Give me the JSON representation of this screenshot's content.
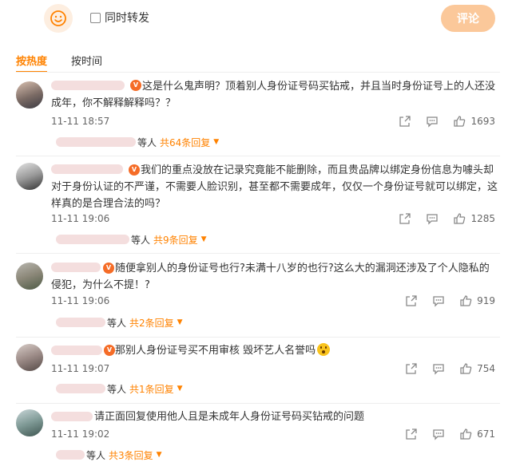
{
  "composer": {
    "forward_label": "同时转发",
    "submit_label": "评论"
  },
  "tabs": {
    "hot": "按热度",
    "time": "按时间"
  },
  "comments": [
    {
      "text": "这是什么鬼声明？顶着别人身份证号码买钻戒，并且当时身份证号上的人还没成年，你不解释解释吗？？",
      "time": "11-11 18:57",
      "likes": "1693",
      "reply_prefix": "等人",
      "reply_count": "共64条回复"
    },
    {
      "text": "我们的重点没放在记录究竟能不能删除，而且贵品牌以绑定身份信息为噱头却对于身份认证的不严谨，不需要人脸识别，甚至都不需要成年，仅仅一个身份证号就可以绑定，这样真的是合理合法的吗？",
      "time": "11-11 19:06",
      "likes": "1285",
      "reply_prefix": "等人",
      "reply_count": "共9条回复"
    },
    {
      "text": "随便拿别人的身份证号也行?未满十八岁的也行?这么大的漏洞还涉及了个人隐私的侵犯，为什么不提！?",
      "time": "11-11 19:06",
      "likes": "919",
      "reply_prefix": "等人",
      "reply_count": "共2条回复"
    },
    {
      "text": "那别人身份证号买不用审核 毁坏艺人名誉吗",
      "time": "11-11 19:07",
      "likes": "754",
      "reply_prefix": "等人",
      "reply_count": "共1条回复"
    },
    {
      "text": "请正面回复使用他人且是未成年人身份证号码买钻戒的问题",
      "time": "11-11 19:02",
      "likes": "671",
      "reply_prefix": "等人",
      "reply_count": "共3条回复"
    }
  ],
  "colors": {
    "accent": "#ff8200",
    "submit_bg": "#fbc89a"
  },
  "icons": {
    "emoji": "smiley-icon",
    "share": "share-icon",
    "comment": "comment-icon",
    "like": "thumbs-up-icon",
    "expand": "caret-down-icon"
  }
}
